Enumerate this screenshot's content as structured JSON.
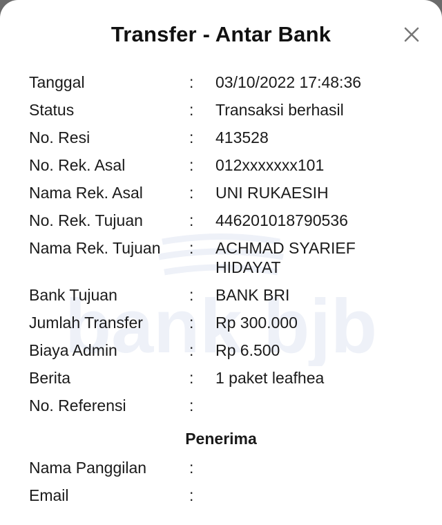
{
  "dialog": {
    "title": "Transfer - Antar Bank",
    "close_icon": "close-icon",
    "watermark_text": "bank bjb"
  },
  "separator": ":",
  "details": [
    {
      "label": "Tanggal",
      "value": "03/10/2022 17:48:36"
    },
    {
      "label": "Status",
      "value": "Transaksi berhasil"
    },
    {
      "label": "No. Resi",
      "value": "413528"
    },
    {
      "label": "No. Rek. Asal",
      "value": "012xxxxxxx101"
    },
    {
      "label": "Nama Rek. Asal",
      "value": "UNI RUKAESIH"
    },
    {
      "label": "No. Rek. Tujuan",
      "value": "446201018790536"
    },
    {
      "label": "Nama Rek. Tujuan",
      "value": "ACHMAD SYARIEF HIDAYAT"
    },
    {
      "label": "Bank Tujuan",
      "value": "BANK BRI"
    },
    {
      "label": "Jumlah Transfer",
      "value": "Rp 300.000"
    },
    {
      "label": "Biaya Admin",
      "value": "Rp 6.500"
    },
    {
      "label": "Berita",
      "value": "1 paket leafhea"
    },
    {
      "label": "No. Referensi",
      "value": ""
    }
  ],
  "recipient": {
    "heading": "Penerima",
    "rows": [
      {
        "label": "Nama Panggilan",
        "value": ""
      },
      {
        "label": "Email",
        "value": ""
      }
    ]
  }
}
